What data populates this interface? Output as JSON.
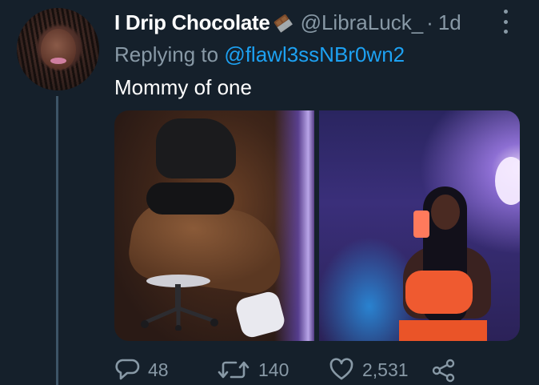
{
  "tweet": {
    "display_name": "I Drip Chocolate",
    "name_emoji": "chocolate-bar-emoji",
    "handle": "@LibraLuck_",
    "separator": "·",
    "time": "1d",
    "reply_prefix": "Replying to",
    "reply_to": "@flawl3ssNBr0wn2",
    "text": "Mommy of one",
    "media": [
      {
        "name": "photo-left",
        "kind": "image"
      },
      {
        "name": "photo-right",
        "kind": "image"
      }
    ]
  },
  "actions": {
    "reply_icon": "speech-bubble-icon",
    "reply_count": "48",
    "retweet_icon": "retweet-icon",
    "retweet_count": "140",
    "like_icon": "heart-icon",
    "like_count": "2,531",
    "share_icon": "share-icon"
  },
  "colors": {
    "background": "#15202b",
    "primary_text": "#ffffff",
    "secondary_text": "#8899a6",
    "link": "#1da1f2",
    "thread_line": "#3d5466"
  }
}
